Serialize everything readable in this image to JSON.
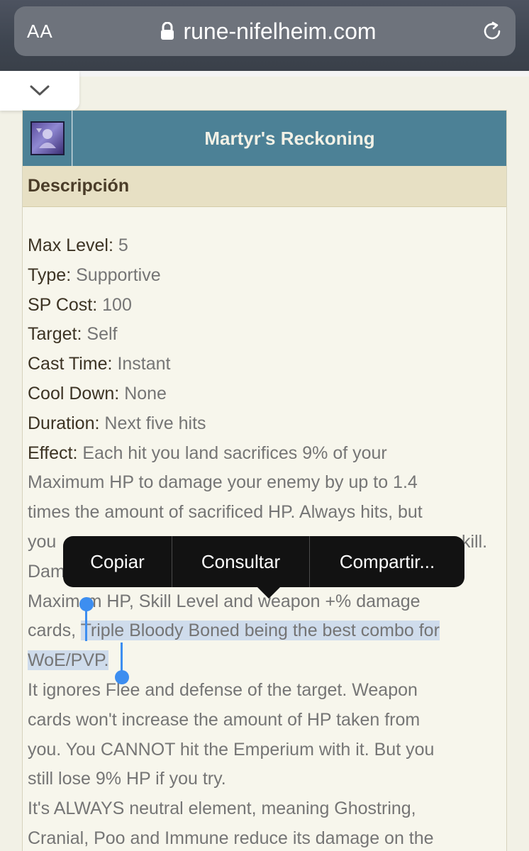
{
  "browser": {
    "text_size_label": "AA",
    "url": "rune-nifelheim.com",
    "lock_icon": "lock-icon",
    "reload_icon": "reload-icon",
    "collapse_icon": "chevron-down-icon"
  },
  "skill": {
    "name": "Martyr's Reckoning",
    "icon": "skill-icon"
  },
  "section": {
    "title": "Descripción"
  },
  "attributes": [
    {
      "key": "Max Level:",
      "value": "5"
    },
    {
      "key": "Type:",
      "value": "Supportive"
    },
    {
      "key": "SP Cost:",
      "value": "100"
    },
    {
      "key": "Target:",
      "value": "Self"
    },
    {
      "key": "Cast Time:",
      "value": "Instant"
    },
    {
      "key": "Cool Down:",
      "value": "None"
    },
    {
      "key": "Duration:",
      "value": "Next five hits"
    }
  ],
  "effect": {
    "key": "Effect:",
    "line1": "Each hit you land sacrifices 9% of your",
    "line2": "Maximum HP to damage your enemy by up to 1.4",
    "line3": "times the amount of sacrificed HP. Always hits, but",
    "line4_start": "you",
    "line4_end": "kill.",
    "line5_start": "Dam",
    "line6_start": "Maxim",
    "line6_end": "m HP, Skill Level and weapon +% damage",
    "line7_plain": "cards, ",
    "line7_selected": "Triple Bloody Boned being the best combo for",
    "line8_selected": "WoE/PVP."
  },
  "paragraphs": [
    "It ignores Flee and defense of the target. Weapon",
    "cards won't increase the amount of HP taken from",
    "you. You CANNOT hit the Emperium with it. But you",
    "still lose 9% HP if you try.",
    "It's ALWAYS neutral element, meaning Ghostring,",
    "Cranial, Poo and Immune reduce its damage on the"
  ],
  "context_menu": {
    "copy": "Copiar",
    "lookup": "Consultar",
    "share": "Compartir..."
  },
  "colors": {
    "header": "#4c8196",
    "desc_bar": "#e7e0c4",
    "selection": "#cfdcec",
    "handle": "#3d8ef0"
  }
}
